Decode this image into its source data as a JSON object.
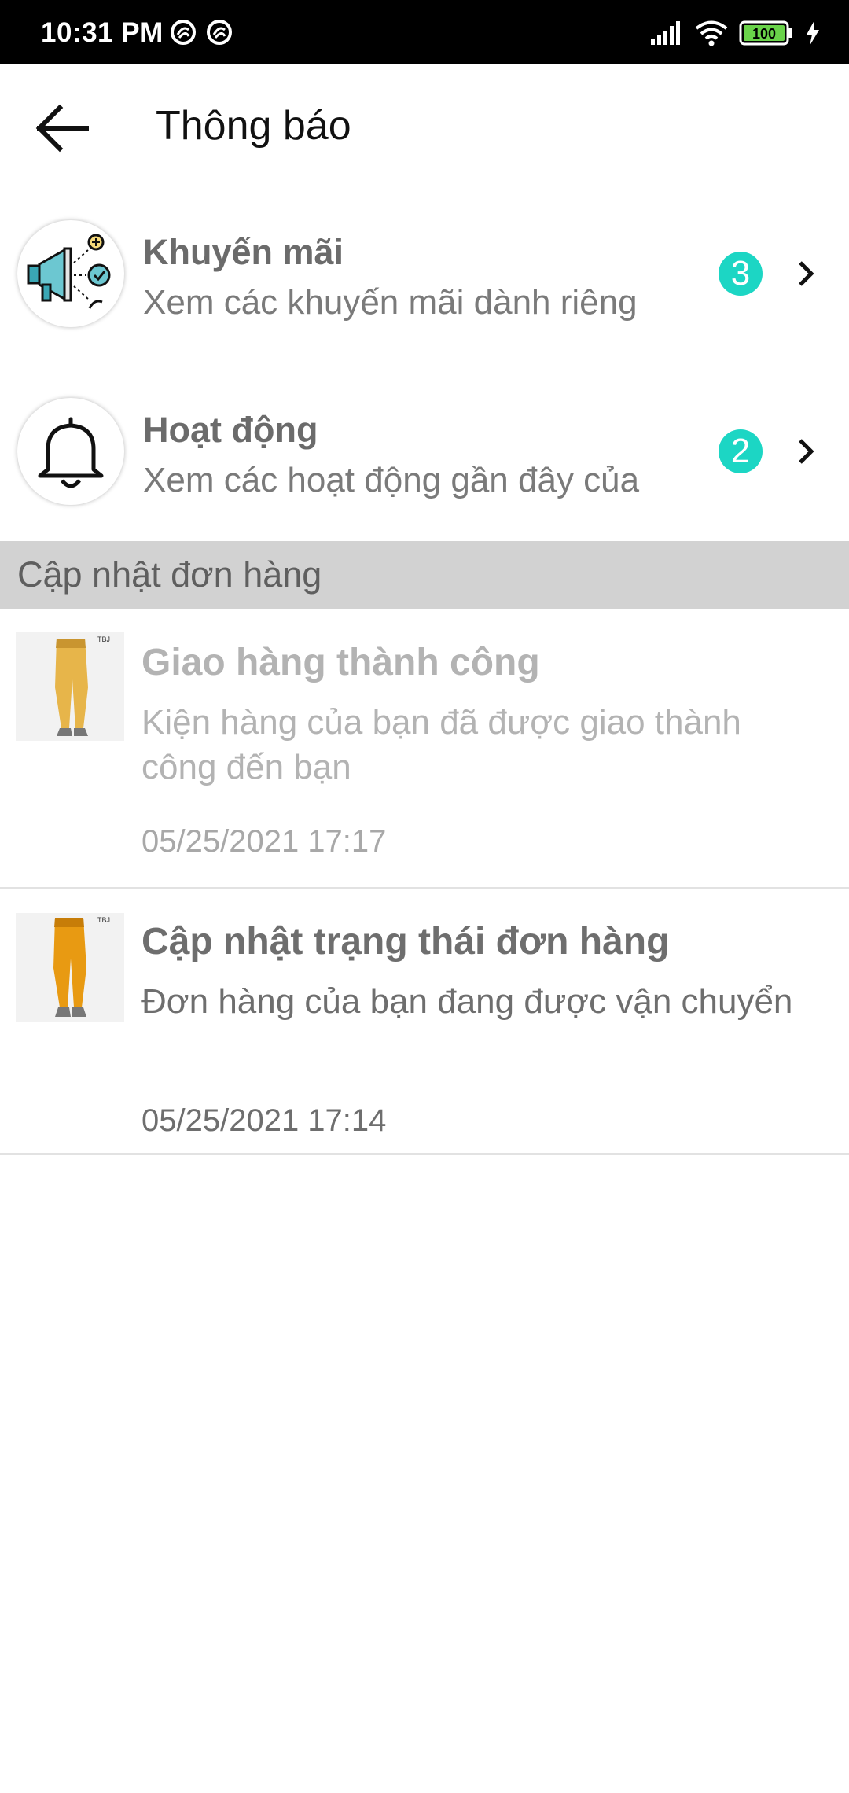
{
  "status_bar": {
    "time": "10:31 PM",
    "battery": "100",
    "icons": [
      "notification-icon",
      "notification-icon",
      "signal-icon",
      "wifi-icon",
      "battery-icon",
      "charging-icon"
    ]
  },
  "header": {
    "title": "Thông báo",
    "back_icon": "arrow-left-icon"
  },
  "categories": [
    {
      "title": "Khuyến mãi",
      "subtitle": "Xem các khuyến mãi dành riêng",
      "count": "3",
      "icon": "megaphone-icon"
    },
    {
      "title": "Hoạt động",
      "subtitle": "Xem các hoạt động gần đây của",
      "count": "2",
      "icon": "bell-icon"
    }
  ],
  "section": {
    "title": "Cập nhật đơn hàng"
  },
  "orders": [
    {
      "title": "Giao hàng thành công",
      "message": "Kiện hàng của bạn đã được giao thành công đến bạn",
      "time": "05/25/2021 17:17",
      "thumb_label": "TBJ",
      "read": true
    },
    {
      "title": "Cập nhật trạng thái đơn hàng",
      "message": "Đơn hàng của bạn đang được vận chuyển",
      "time": "05/25/2021 17:14",
      "thumb_label": "TBJ",
      "read": false
    }
  ],
  "colors": {
    "badge": "#1cd6c4",
    "section_bg": "#d2d2d2",
    "status_bar": "#000000",
    "battery_fill": "#6ad34a"
  }
}
